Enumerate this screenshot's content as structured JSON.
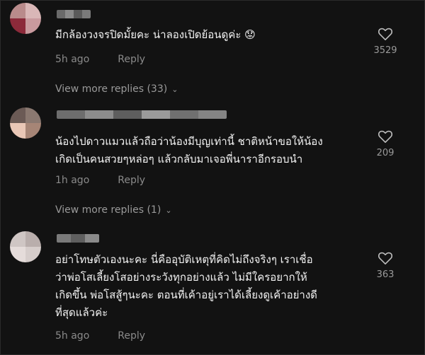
{
  "comments": [
    {
      "text": "มีกล้องวงจรปิดมั้ยคะ น่าลองเปิดย้อนดูค่ะ 😟",
      "time": "5h ago",
      "reply_label": "Reply",
      "likes": "3529",
      "more_replies": "View more replies (33)"
    },
    {
      "text": "น้องไปดาวแมวแล้วถือว่าน้องมีบุญเท่านี้ ชาติหน้าขอให้น้อง\nเกิดเป็นคนสวยๆหล่อๆ แล้วกลับมาเจอพี่นาราอีกรอบนำ",
      "time": "1h ago",
      "reply_label": "Reply",
      "likes": "209",
      "more_replies": "View more replies (1)"
    },
    {
      "text": "อย่าโทษตัวเองนะคะ นี่คืออุบัติเหตุที่คิดไม่ถึงจริงๆ เราเชื่อ\nว่าพ่อโสเลี้ยงโสอย่างระวังทุกอย่างแล้ว ไม่มีใครอยากให้\nเกิดขึ้น พ่อโสสู้ๆนะคะ ตอนที่เค้าอยู่เราได้เลี้ยงดูเค้าอย่างดี\nที่สุดแล้วค่ะ",
      "time": "5h ago",
      "reply_label": "Reply",
      "likes": "363"
    }
  ],
  "icons": {
    "like": "heart-outline-icon",
    "expand": "chevron-down-icon"
  },
  "colors": {
    "background": "#121212",
    "text": "#f2f2f2",
    "muted": "#8a8a8a"
  }
}
